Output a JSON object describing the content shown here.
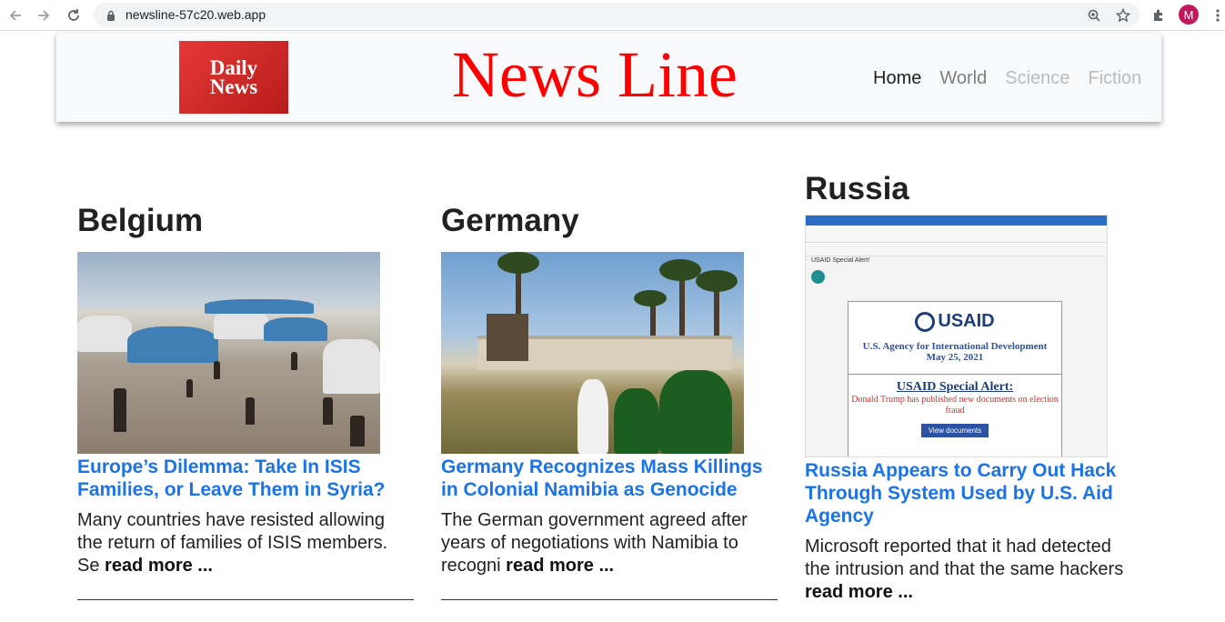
{
  "browser": {
    "url": "newsline-57c20.web.app",
    "profile_initial": "M"
  },
  "header": {
    "logo_line1": "Daily",
    "logo_line2": "News",
    "brand": "News Line",
    "nav": [
      "Home",
      "World",
      "Science",
      "Fiction"
    ]
  },
  "articles": [
    {
      "country": "Belgium",
      "headline": "Europe’s Dilemma: Take In ISIS Families, or Leave Them in Syria?",
      "summary": "Many countries have resisted allowing the return of families of ISIS members. Se",
      "read_more": "read more ..."
    },
    {
      "country": "Germany",
      "headline": "Germany Recognizes Mass Killings in Colonial Namibia as Genocide",
      "summary": "The German government agreed after years of negotiations with Namibia to recogni",
      "read_more": "read more ..."
    },
    {
      "country": "Russia",
      "headline": "Russia Appears to Carry Out Hack Through System Used by U.S. Aid Agency",
      "summary": "Microsoft reported that it had detected the intrusion and that the same hackers",
      "read_more": "read more ..."
    }
  ],
  "email_image": {
    "subject": "USAID Special Alert!",
    "logo": "USAID",
    "agency": "U.S. Agency for International Development",
    "date": "May 25, 2021",
    "alert_title": "USAID Special Alert:",
    "alert_text": "Donald Trump has published new documents on election fraud",
    "button": "View documents"
  },
  "colors": {
    "brand_red": "#ff0000",
    "headline_blue": "#1a73e8"
  }
}
